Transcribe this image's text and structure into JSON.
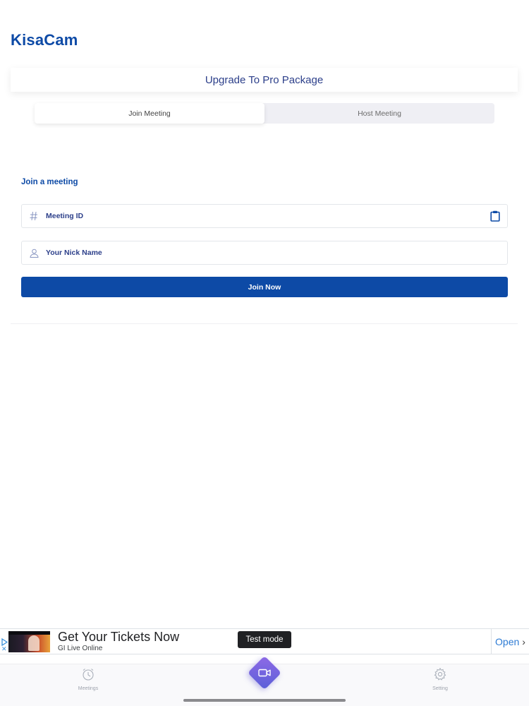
{
  "app": {
    "title": "KisaCam"
  },
  "upgrade": {
    "label": "Upgrade To Pro Package"
  },
  "tabs": [
    {
      "label": "Join Meeting",
      "active": true
    },
    {
      "label": "Host Meeting",
      "active": false
    }
  ],
  "join": {
    "section_title": "Join a meeting",
    "meeting_id": {
      "placeholder": "Meeting ID",
      "value": "",
      "icon": "hash-icon",
      "action_icon": "clipboard-icon"
    },
    "nick_name": {
      "placeholder": "Your Nick Name",
      "value": "",
      "icon": "person-icon"
    },
    "button_label": "Join Now"
  },
  "ad": {
    "headline": "Get Your Tickets Now",
    "advertiser": "GI Live Online",
    "badge": "Test mode",
    "cta": "Open"
  },
  "tabbar": {
    "items": [
      {
        "label": "Meetings",
        "icon": "clock-icon"
      },
      {
        "label": "",
        "icon": "video-camera-icon"
      },
      {
        "label": "Setting",
        "icon": "gear-icon"
      }
    ]
  },
  "colors": {
    "brand": "#0d4aa6",
    "accent_purple": "#7b64e2",
    "text_navy": "#2c3f8a"
  }
}
